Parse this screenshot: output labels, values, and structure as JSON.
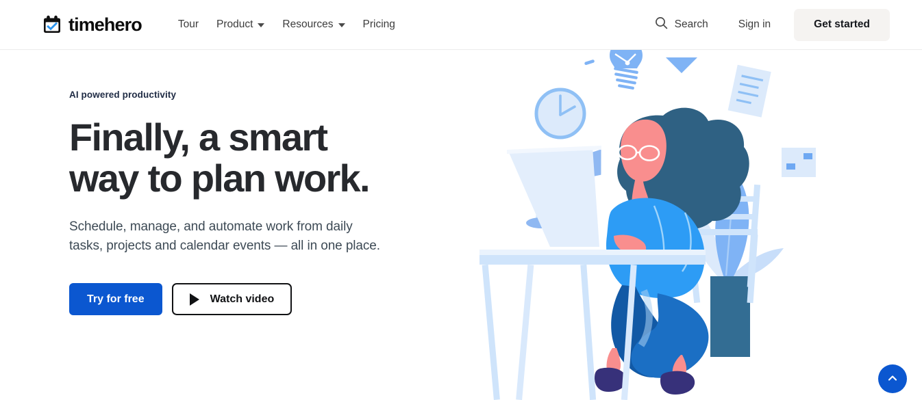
{
  "brand": {
    "name": "timehero",
    "logo_icon": "calendar-check-icon",
    "logo_check_color": "#2b95f0",
    "logo_text_color": "#0c0c0c"
  },
  "nav": {
    "items": [
      {
        "label": "Tour",
        "has_dropdown": false
      },
      {
        "label": "Product",
        "has_dropdown": true
      },
      {
        "label": "Resources",
        "has_dropdown": true
      },
      {
        "label": "Pricing",
        "has_dropdown": false
      }
    ]
  },
  "header_right": {
    "search_icon": "search-icon",
    "search_label": "Search",
    "signin_label": "Sign in",
    "get_started_label": "Get started",
    "get_started_bg": "#f5f3f1"
  },
  "hero": {
    "eyebrow": "AI powered productivity",
    "headline": "Finally, a smart\nway to plan work.",
    "subhead": "Schedule, manage, and automate work from daily\ntasks, projects and calendar events — all in one place.",
    "primary_cta": "Try for free",
    "secondary_cta": "Watch video",
    "secondary_cta_icon": "play-icon",
    "accent_color": "#0b57d0",
    "headline_color": "#27292d",
    "eyebrow_color": "#1f2b44"
  },
  "illustration": {
    "name": "woman-working-at-desk-illustration",
    "elements": [
      "wall-clock",
      "lightbulb",
      "triangle",
      "desk-lamp",
      "laptop",
      "desk",
      "chair",
      "document-page",
      "chart-card",
      "potted-plant",
      "seated-woman"
    ],
    "palette": {
      "hair_navy": "#2f6183",
      "skin_pink": "#f98e8e",
      "sweater_blue": "#2d9cf5",
      "jeans_blue": "#1259a5",
      "light_blue": "#cfe4fb",
      "pale_blue": "#e3eefc",
      "mid_blue": "#7fb3f5",
      "pot_teal": "#336d93",
      "shoe_purple": "#37317a"
    }
  },
  "scroll_top": {
    "icon": "chevron-up-icon",
    "bg": "#0b57d0",
    "label": ""
  }
}
